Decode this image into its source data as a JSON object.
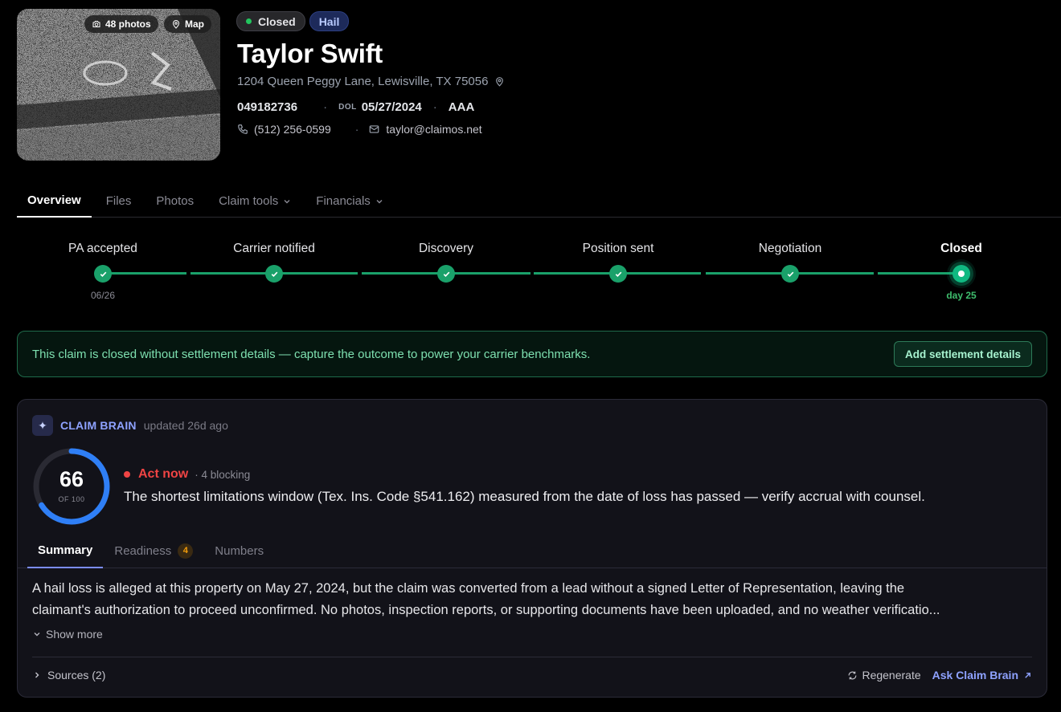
{
  "photo": {
    "photos_label": "48 photos",
    "map_label": "Map"
  },
  "status_badge": "Closed",
  "peril_badge": "Hail",
  "claimant": {
    "name": "Taylor Swift",
    "address": "1204 Queen Peggy Lane, Lewisville, TX 75056",
    "claim_number": "049182736",
    "dol_label": "DOL",
    "dol": "05/27/2024",
    "carrier": "AAA",
    "phone": "(512) 256-0599",
    "email": "taylor@claimos.net"
  },
  "tabs": [
    {
      "label": "Overview",
      "active": true
    },
    {
      "label": "Files"
    },
    {
      "label": "Photos"
    },
    {
      "label": "Claim tools",
      "dropdown": true
    },
    {
      "label": "Financials",
      "dropdown": true
    }
  ],
  "stepper": [
    {
      "label": "PA accepted",
      "sub": "06/26",
      "state": "done"
    },
    {
      "label": "Carrier notified",
      "sub": "",
      "state": "done"
    },
    {
      "label": "Discovery",
      "sub": "",
      "state": "done"
    },
    {
      "label": "Position sent",
      "sub": "",
      "state": "done"
    },
    {
      "label": "Negotiation",
      "sub": "",
      "state": "done"
    },
    {
      "label": "Closed",
      "sub": "day 25",
      "state": "current"
    }
  ],
  "banner": {
    "text": "This claim is closed without settlement details — capture the outcome to power your carrier benchmarks.",
    "button": "Add settlement details"
  },
  "claim_brain": {
    "title": "CLAIM BRAIN",
    "updated": "updated 26d ago",
    "score": 66,
    "score_fraction": 0.66,
    "score_of": "OF 100",
    "status": "Act now",
    "blocking": "· 4 blocking",
    "headline": "The shortest limitations window (Tex. Ins. Code §541.162) measured from the date of loss has passed — verify accrual with counsel.",
    "tabs": [
      {
        "label": "Summary",
        "active": true
      },
      {
        "label": "Readiness",
        "count": "4"
      },
      {
        "label": "Numbers"
      }
    ],
    "summary_line1": "A hail loss is alleged at this property on May 27, 2024, but the claim was converted from a lead without a signed Letter of Representation, leaving the",
    "summary_line2": "claimant's authorization to proceed unconfirmed. No photos, inspection reports, or supporting documents have been uploaded, and no weather verificatio...",
    "show_more": "Show more",
    "sources": "Sources (2)",
    "regenerate": "Regenerate",
    "ask": "Ask Claim Brain"
  },
  "colors": {
    "accent_green": "#1aa16a",
    "danger": "#ef4444",
    "brand": "#8ea2ff",
    "gauge_blue": "#2f7ff6"
  }
}
